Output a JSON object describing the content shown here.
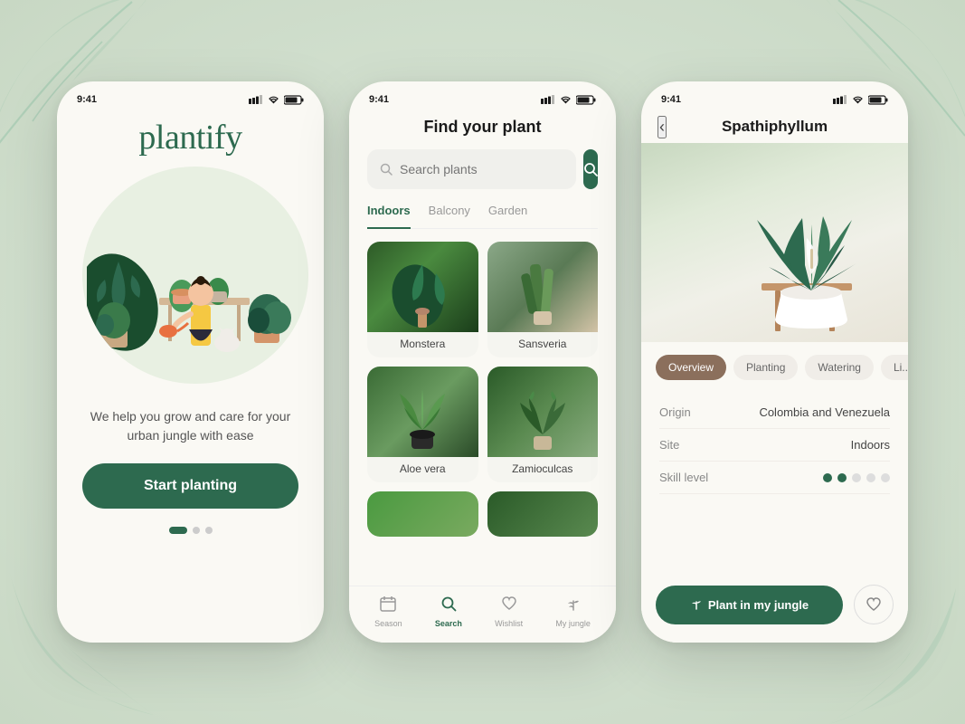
{
  "background": {
    "color": "#dde8db"
  },
  "screen1": {
    "status_time": "9:41",
    "logo": "plantify",
    "tagline": "We help you grow and care for your urban jungle with ease",
    "cta_button": "Start planting",
    "dots": [
      "active",
      "inactive",
      "inactive"
    ]
  },
  "screen2": {
    "status_time": "9:41",
    "title": "Find your plant",
    "search_placeholder": "Search plants",
    "tabs": [
      {
        "label": "Indoors",
        "active": true
      },
      {
        "label": "Balcony",
        "active": false
      },
      {
        "label": "Garden",
        "active": false
      }
    ],
    "plants": [
      {
        "name": "Monstera",
        "style": "monstera"
      },
      {
        "name": "Sansveria",
        "style": "sansveria"
      },
      {
        "name": "Aloe vera",
        "style": "aloe"
      },
      {
        "name": "Zamioculcas",
        "style": "zz"
      }
    ],
    "nav": [
      {
        "label": "Season",
        "icon": "📅",
        "active": false
      },
      {
        "label": "Search",
        "icon": "🔍",
        "active": true
      },
      {
        "label": "Wishlist",
        "icon": "🤍",
        "active": false
      },
      {
        "label": "My jungle",
        "icon": "🌿",
        "active": false
      }
    ]
  },
  "screen3": {
    "status_time": "9:41",
    "plant_name": "Spathiphyllum",
    "tabs": [
      {
        "label": "Overview",
        "active": true
      },
      {
        "label": "Planting",
        "active": false
      },
      {
        "label": "Watering",
        "active": false
      },
      {
        "label": "Li...",
        "active": false
      }
    ],
    "details": [
      {
        "label": "Origin",
        "value": "Colombia and Venezuela"
      },
      {
        "label": "Site",
        "value": "Indoors"
      },
      {
        "label": "Skill level",
        "value": "dots",
        "filled": 2,
        "total": 5
      }
    ],
    "cta_button": "Plant in my jungle",
    "back_icon": "‹"
  }
}
